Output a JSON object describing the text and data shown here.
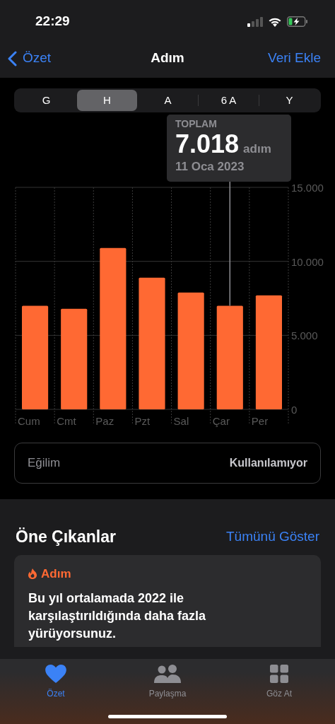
{
  "status_bar": {
    "time": "22:29"
  },
  "nav": {
    "back": "Özet",
    "title": "Adım",
    "action": "Veri Ekle"
  },
  "segments": [
    {
      "label": "G",
      "selected": false
    },
    {
      "label": "H",
      "selected": true
    },
    {
      "label": "A",
      "selected": false
    },
    {
      "label": "6 A",
      "selected": false
    },
    {
      "label": "Y",
      "selected": false
    }
  ],
  "selection": {
    "label": "TOPLAM",
    "value": "7.018",
    "unit": "adım",
    "date": "11 Oca 2023"
  },
  "chart_data": {
    "type": "bar",
    "categories": [
      "Cum",
      "Cmt",
      "Paz",
      "Pzt",
      "Sal",
      "Çar",
      "Per"
    ],
    "series": [
      {
        "color": "#ff6933",
        "values": [
          7000,
          6800,
          10900,
          8900,
          7900,
          7000,
          7700
        ]
      }
    ],
    "ylim": [
      0,
      15000
    ],
    "yticks": [
      {
        "value": 0,
        "label": "0"
      },
      {
        "value": 5000,
        "label": "5.000"
      },
      {
        "value": 10000,
        "label": "10.000"
      },
      {
        "value": 15000,
        "label": "15.000"
      }
    ]
  },
  "bars": [
    {
      "selected": false
    },
    {
      "selected": false
    },
    {
      "selected": false
    },
    {
      "selected": false
    },
    {
      "selected": false
    },
    {
      "selected": true
    },
    {
      "selected": false
    }
  ],
  "trend": {
    "label": "Eğilim",
    "value": "Kullanılamıyor"
  },
  "highlights": {
    "title": "Öne Çıkanlar",
    "link": "Tümünü Göster",
    "card": {
      "category": "Adım",
      "text": "Bu yıl ortalamada 2022 ile karşılaştırıldığında daha fazla yürüyorsunuz."
    }
  },
  "tab_bar": [
    {
      "label": "Özet",
      "selected": true
    },
    {
      "label": "Paylaşma",
      "selected": false
    },
    {
      "label": "Göz At",
      "selected": false
    }
  ]
}
